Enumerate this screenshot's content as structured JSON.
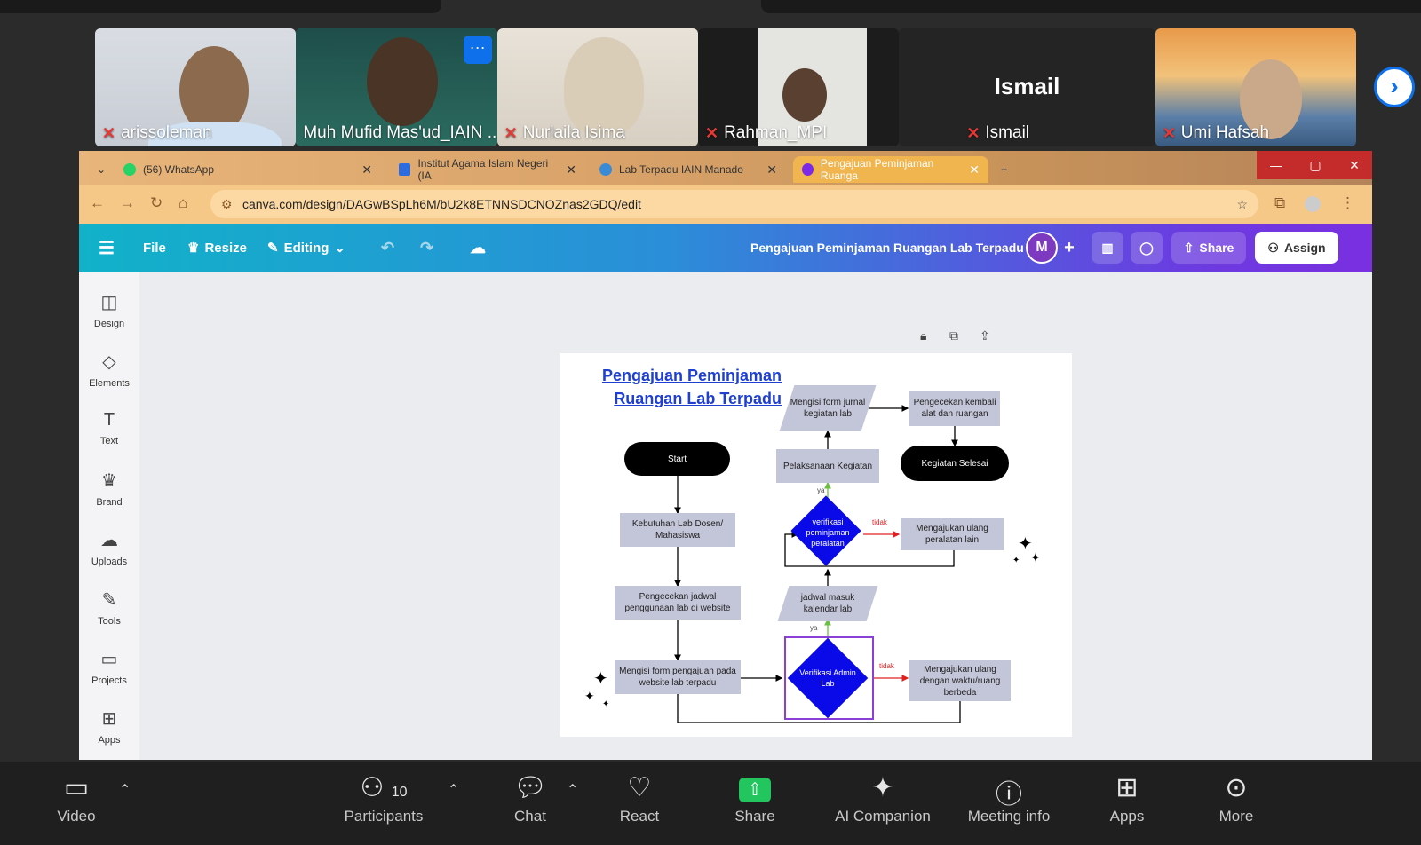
{
  "participants": [
    {
      "name": "arissoleman"
    },
    {
      "name": "Muh Mufid Mas'ud_IAIN ..."
    },
    {
      "name": "Nurlaila Isima"
    },
    {
      "name": "Rahman_MPI"
    },
    {
      "name": "Ismail",
      "display_name": "Ismail"
    },
    {
      "name": "Umi Hafsah"
    }
  ],
  "tile_more": "···",
  "next_icon": "›",
  "browser": {
    "tabs": [
      {
        "label": "(56) WhatsApp"
      },
      {
        "label": "Institut Agama Islam Negeri (IA"
      },
      {
        "label": "Lab Terpadu IAIN Manado"
      },
      {
        "label": "Pengajuan Peminjaman Ruanga"
      }
    ],
    "url": "canva.com/design/DAGwBSpLh6M/bU2k8ETNNSDCNOZnas2GDQ/edit"
  },
  "canva": {
    "file": "File",
    "resize": "Resize",
    "editing": "Editing",
    "doc_title": "Pengajuan Peminjaman Ruangan Lab Terpadu",
    "avatar": "M",
    "share": "Share",
    "assign": "Assign",
    "sidebar": [
      "Design",
      "Elements",
      "Text",
      "Brand",
      "Uploads",
      "Tools",
      "Projects",
      "Apps"
    ]
  },
  "flowchart": {
    "title_line1": "Pengajuan Peminjaman",
    "title_line2": "Ruangan Lab Terpadu",
    "start": "Start",
    "kebutuhan": "Kebutuhan Lab Dosen/ Mahasiswa",
    "pengecekan_jadwal": "Pengecekan jadwal penggunaan lab di website",
    "mengisi_form_pengajuan": "Mengisi form pengajuan pada website lab terpadu",
    "verifikasi_admin": "Verifikasi Admin Lab",
    "mengajukan_waktu": "Mengajukan ulang dengan waktu/ruang berbeda",
    "jadwal_masuk": "jadwal masuk kalendar lab",
    "verifikasi_peralatan": "verifikasi peminjaman peralatan",
    "mengajukan_peralatan": "Mengajukan ulang peralatan lain",
    "pelaksanaan": "Pelaksanaan Kegiatan",
    "mengisi_jurnal": "Mengisi form jurnal kegiatan lab",
    "pengecekan_kembali": "Pengecekan kembali alat dan ruangan",
    "selesai": "Kegiatan Selesai",
    "ya": "ya",
    "tidak": "tidak"
  },
  "zoom_toolbar": {
    "video": "Video",
    "participants": "Participants",
    "participant_count": "10",
    "chat": "Chat",
    "react": "React",
    "share": "Share",
    "ai": "AI Companion",
    "meeting_info": "Meeting info",
    "apps": "Apps",
    "more": "More"
  },
  "colors": {
    "share_green": "#22c55e",
    "zoom_blue": "#0e71eb",
    "diamond_blue": "#0a0ae8"
  }
}
